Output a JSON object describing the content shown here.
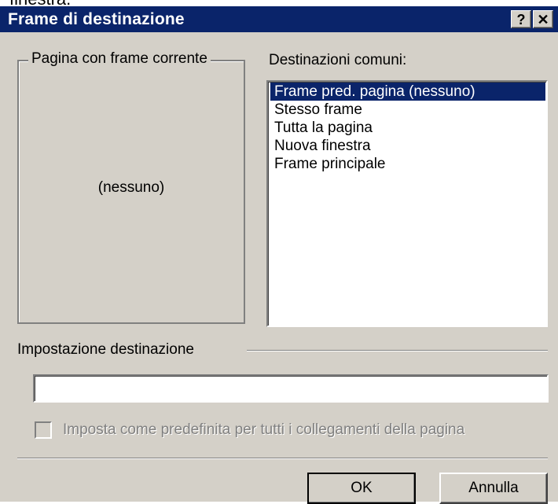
{
  "header_fragment": "finestra.",
  "window": {
    "title": "Frame di destinazione",
    "help_label": "?",
    "close_label": "✕"
  },
  "current_frame": {
    "label": "Pagina con frame corrente",
    "value": "(nessuno)"
  },
  "common_destinations": {
    "label": "Destinazioni comuni:",
    "items": [
      {
        "label": "Frame pred. pagina (nessuno)",
        "selected": true
      },
      {
        "label": "Stesso frame",
        "selected": false
      },
      {
        "label": "Tutta la pagina",
        "selected": false
      },
      {
        "label": "Nuova finestra",
        "selected": false
      },
      {
        "label": "Frame principale",
        "selected": false
      }
    ]
  },
  "target_setting": {
    "label": "Impostazione destinazione",
    "value": ""
  },
  "default_checkbox": {
    "label": "Imposta come predefinita per tutti i collegamenti della pagina",
    "checked": false,
    "enabled": false
  },
  "buttons": {
    "ok": "OK",
    "cancel": "Annulla"
  }
}
